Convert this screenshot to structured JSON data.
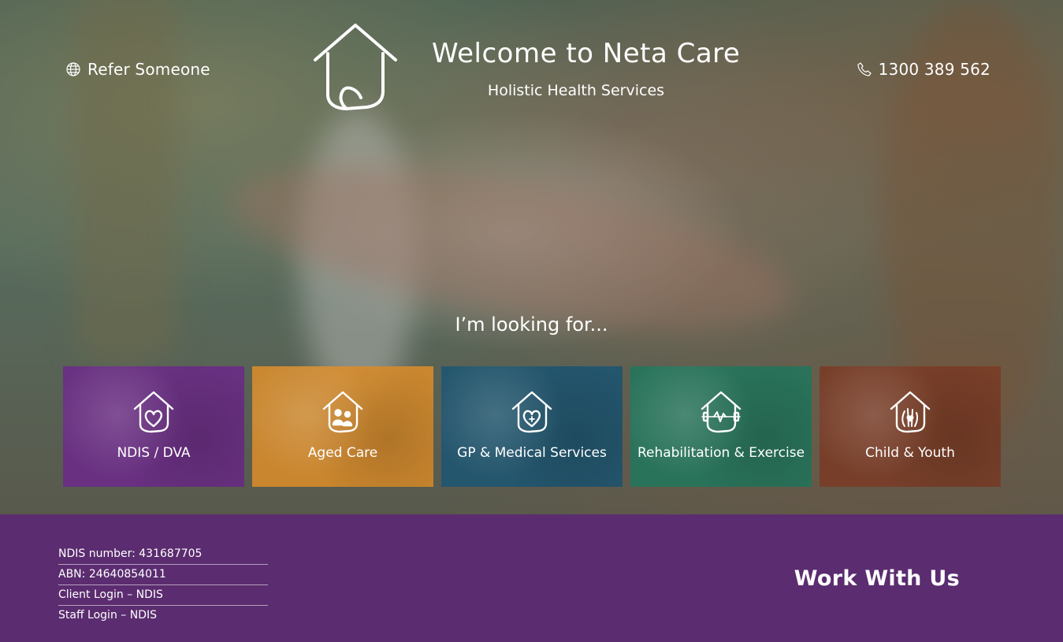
{
  "header": {
    "refer_label": "Refer Someone",
    "phone_label": "1300 389 562",
    "title": "Welcome to Neta Care",
    "subtitle": "Holistic Health Services"
  },
  "hero": {
    "prompt": "I’m looking for..."
  },
  "tiles": [
    {
      "label": "NDIS / DVA",
      "color": "#6a2c86",
      "icon": "heart-house-icon"
    },
    {
      "label": "Aged Care",
      "color": "#d98c2a",
      "icon": "family-house-icon"
    },
    {
      "label": "GP & Medical Services",
      "color": "#1f5670",
      "icon": "medical-heart-house-icon"
    },
    {
      "label": "Rehabilitation & Exercise",
      "color": "#23755c",
      "icon": "dumbbell-house-icon"
    },
    {
      "label": "Child & Youth",
      "color": "#7a3b25",
      "icon": "hand-heart-house-icon"
    }
  ],
  "footer": {
    "info": [
      "NDIS number: 431687705",
      "ABN: 24640854011",
      "Client Login – NDIS",
      "Staff Login – NDIS"
    ],
    "work_with_us": "Work With Us",
    "background": "#5b2c6f"
  }
}
